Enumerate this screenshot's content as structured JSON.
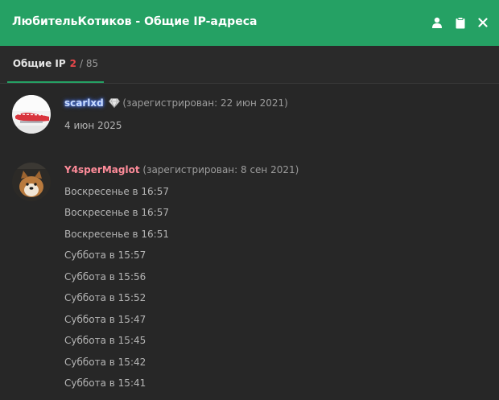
{
  "window": {
    "title": "ЛюбительКотиков - Общие IP-адреса"
  },
  "header_icons": [
    "user-icon",
    "clipboard-icon",
    "close-icon"
  ],
  "tab": {
    "label": "Общие IP",
    "count": "2",
    "total": "/ 85"
  },
  "entries": [
    {
      "username": "scarlxd",
      "badge": "diamond-icon",
      "registered": "(зарегистрирован: 22 июн 2021)",
      "dates": [
        "4 июн 2025"
      ]
    },
    {
      "username": "Y4sperMaglot",
      "registered": "(зарегистрирован: 8 сен 2021)",
      "dates": [
        "Воскресенье в 16:57",
        "Воскресенье в 16:57",
        "Воскресенье в 16:51",
        "Суббота в 15:57",
        "Суббота в 15:56",
        "Суббота в 15:52",
        "Суббота в 15:47",
        "Суббота в 15:45",
        "Суббота в 15:42",
        "Суббота в 15:41"
      ]
    }
  ],
  "colors": {
    "header": "#25a164",
    "background": "#272727",
    "accent_count": "#e8474a",
    "username_2": "#ff8c9a"
  }
}
